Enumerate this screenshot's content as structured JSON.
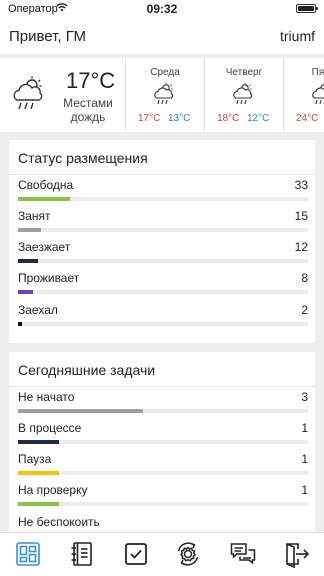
{
  "status_bar": {
    "carrier": "Оператор",
    "time": "09:32"
  },
  "header": {
    "greeting": "Привет, ГМ",
    "user": "triumf"
  },
  "weather": {
    "current": {
      "temp": "17°C",
      "condition": "Местами дождь",
      "icon": "cloud-rain-icon"
    },
    "days": [
      {
        "name": "Среда",
        "hi": "17°C",
        "lo": "13°C",
        "icon": "cloud-rain-sun-icon"
      },
      {
        "name": "Четверг",
        "hi": "18°C",
        "lo": "12°C",
        "icon": "cloud-rain-sun-icon"
      },
      {
        "name": "Пятн",
        "hi": "24°C",
        "lo": "",
        "icon": "cloud-rain-sun-icon"
      }
    ]
  },
  "placement": {
    "title": "Статус размещения",
    "items": [
      {
        "label": "Свободна",
        "value": "33",
        "fraction": 0.18,
        "color": "#8bc34a"
      },
      {
        "label": "Занят",
        "value": "15",
        "fraction": 0.08,
        "color": "#9e9e9e"
      },
      {
        "label": "Заезжает",
        "value": "12",
        "fraction": 0.07,
        "color": "#1f2a44"
      },
      {
        "label": "Проживает",
        "value": "8",
        "fraction": 0.05,
        "color": "#6a3fc2"
      },
      {
        "label": "Заехал",
        "value": "2",
        "fraction": 0.01,
        "color": "#111111"
      }
    ]
  },
  "tasks": {
    "title": "Сегодняшние задачи",
    "items": [
      {
        "label": "Не начато",
        "value": "3",
        "fraction": 0.43,
        "color": "#9e9e9e"
      },
      {
        "label": "В процессе",
        "value": "1",
        "fraction": 0.14,
        "color": "#1f2a44"
      },
      {
        "label": "Пауза",
        "value": "1",
        "fraction": 0.14,
        "color": "#f4c20d"
      },
      {
        "label": "На проверку",
        "value": "1",
        "fraction": 0.14,
        "color": "#8bc34a"
      },
      {
        "label": "Не беспокоить",
        "value": "",
        "fraction": 0,
        "color": "#9e9e9e"
      }
    ]
  },
  "tabbar": {
    "items": [
      {
        "icon": "dashboard-icon",
        "active": true
      },
      {
        "icon": "notebook-icon",
        "active": false
      },
      {
        "icon": "checkbox-icon",
        "active": false
      },
      {
        "icon": "settings-sync-icon",
        "active": false
      },
      {
        "icon": "chat-icon",
        "active": false
      },
      {
        "icon": "logout-icon",
        "active": false
      }
    ],
    "active_color": "#3b8fd9",
    "inactive_color": "#222222"
  }
}
